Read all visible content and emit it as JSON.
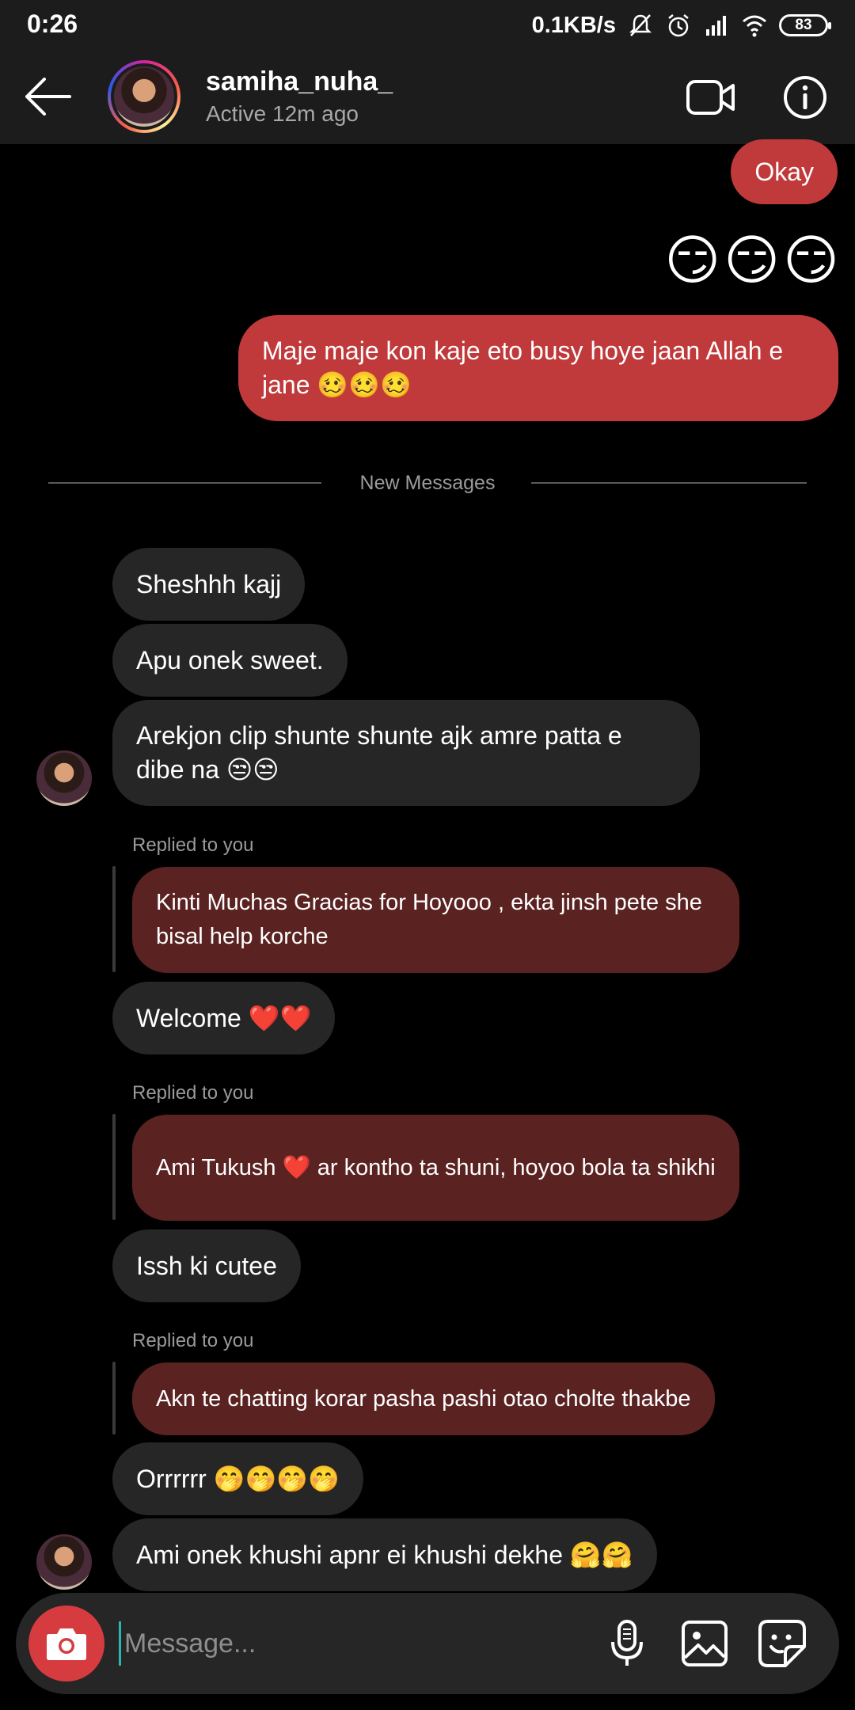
{
  "status_bar": {
    "time": "0:26",
    "network_speed": "0.1KB/s",
    "battery": "83",
    "icons": [
      "mute-icon",
      "alarm-icon",
      "signal-icon",
      "wifi-icon",
      "battery-icon"
    ]
  },
  "header": {
    "username": "samiha_nuha_",
    "status": "Active 12m ago",
    "icons": [
      "back-arrow-icon",
      "video-call-icon",
      "info-icon"
    ]
  },
  "messages": {
    "sent_okay": "Okay",
    "sent_emojis": "😏😏😏",
    "sent_long": "Maje maje kon kaje eto busy hoye jaan Allah e jane 🥴🥴🥴",
    "divider": "New Messages",
    "recv_1": "Sheshhh kajj",
    "recv_2": "Apu onek sweet.",
    "recv_3": "Arekjon clip shunte shunte ajk amre patta e dibe na 😒😒",
    "replied_label": "Replied to you",
    "quote_1": "Kinti Muchas Gracias for Hoyooo , ekta jinsh pete she bisal help korche",
    "recv_4": "Welcome ❤️❤️",
    "quote_2": "Ami Tukush ❤️ ar kontho ta shuni, hoyoo bola ta shikhi",
    "recv_5": "Issh ki cutee",
    "quote_3": "Akn te chatting korar pasha pashi otao cholte thakbe",
    "recv_6": "Orrrrrr 🤭🤭🤭🤭",
    "recv_7": "Ami onek khushi apnr ei khushi dekhe 🤗🤗"
  },
  "composer": {
    "placeholder": "Message...",
    "icons": [
      "camera-icon",
      "microphone-icon",
      "gallery-icon",
      "sticker-icon"
    ]
  },
  "colors": {
    "sent_bubble": "#c0393b",
    "received_bubble": "#262626",
    "reply_quote_bubble": "#5b2222",
    "background": "#000000",
    "header_bg": "#1c1c1c"
  }
}
